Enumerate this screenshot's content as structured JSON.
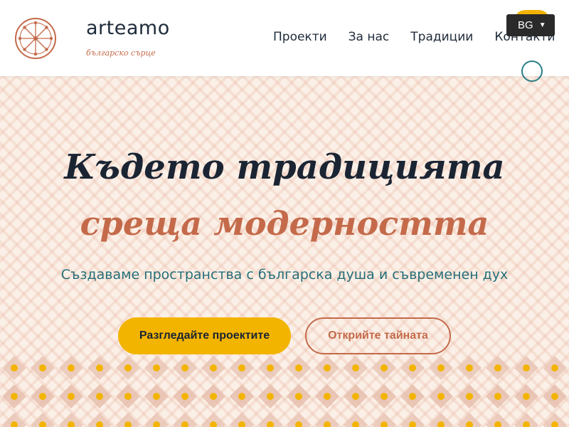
{
  "header": {
    "brand_name": "arteamo",
    "brand_tagline": "българско сърце",
    "nav": [
      {
        "label": "Проекти"
      },
      {
        "label": "За нас"
      },
      {
        "label": "Традиции"
      },
      {
        "label": "Контакти"
      }
    ],
    "language": {
      "selected": "BG"
    }
  },
  "hero": {
    "title_line1": "Където традицията",
    "title_line2": "среща модерността",
    "subtitle": "Създаваме пространства с българска душа и съвременен дух",
    "primary_button": "Разгледайте проектите",
    "secondary_button": "Открийте тайната"
  },
  "colors": {
    "accent_yellow": "#f3b400",
    "accent_terracotta": "#c46a4a",
    "teal": "#256e78",
    "dark": "#1a2433"
  }
}
